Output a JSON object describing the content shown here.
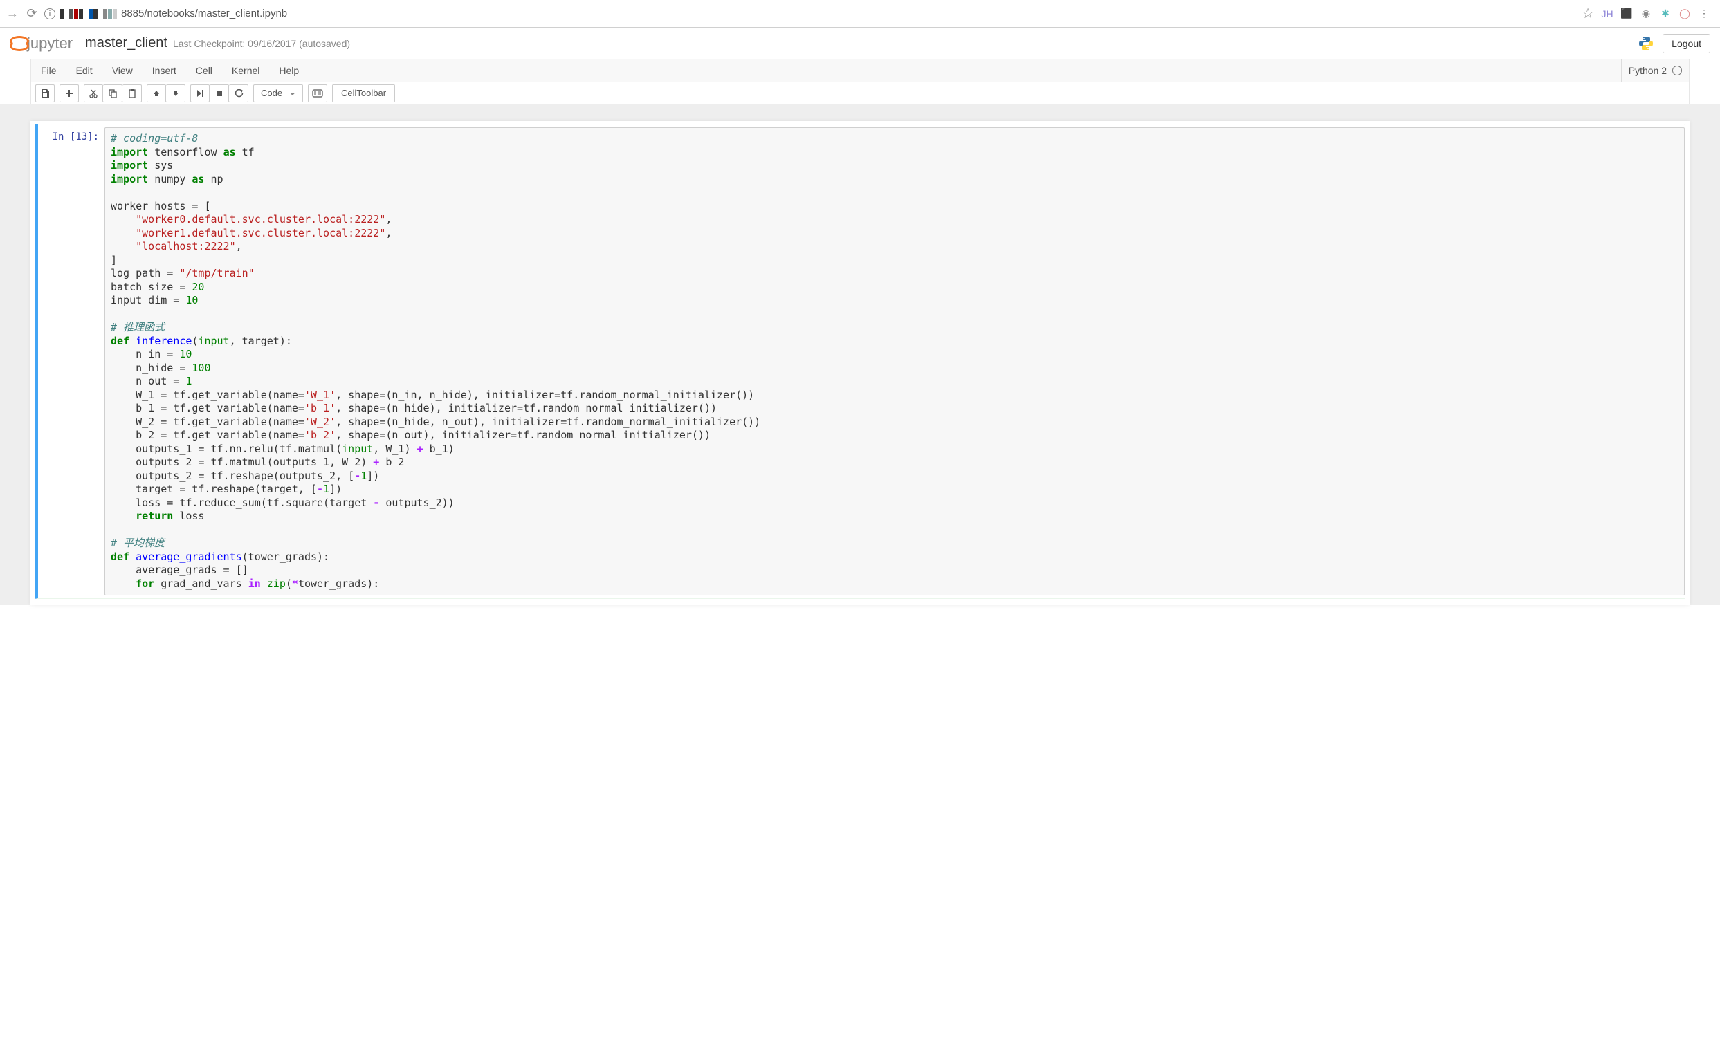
{
  "browser": {
    "url_text": "8885/notebooks/master_client.ipynb",
    "ext_icons": [
      {
        "name": "ext-jh",
        "glyph": "JH",
        "color": "#8b82d6"
      },
      {
        "name": "ext-red",
        "glyph": "⬛",
        "color": "#d66"
      },
      {
        "name": "ext-elephant",
        "glyph": "◉",
        "color": "#888"
      },
      {
        "name": "ext-asterisk",
        "glyph": "✱",
        "color": "#5bb"
      },
      {
        "name": "ext-circle",
        "glyph": "◯",
        "color": "#d88"
      },
      {
        "name": "ext-dots",
        "glyph": "⋮",
        "color": "#666"
      }
    ]
  },
  "header": {
    "logo_text": "jupyter",
    "notebook_name": "master_client",
    "checkpoint": "Last Checkpoint: 09/16/2017 (autosaved)",
    "logout": "Logout"
  },
  "menus": {
    "items": [
      "File",
      "Edit",
      "View",
      "Insert",
      "Cell",
      "Kernel",
      "Help"
    ],
    "kernel": "Python 2"
  },
  "toolbar": {
    "cell_type": "Code",
    "cell_toolbar": "CellToolbar"
  },
  "cell": {
    "prompt": "In [13]:",
    "code_lines": [
      [
        {
          "t": "# coding=utf-8",
          "c": "c-comment"
        }
      ],
      [
        {
          "t": "import",
          "c": "c-keyword"
        },
        {
          "t": " tensorflow "
        },
        {
          "t": "as",
          "c": "c-keyword"
        },
        {
          "t": " tf"
        }
      ],
      [
        {
          "t": "import",
          "c": "c-keyword"
        },
        {
          "t": " sys"
        }
      ],
      [
        {
          "t": "import",
          "c": "c-keyword"
        },
        {
          "t": " numpy "
        },
        {
          "t": "as",
          "c": "c-keyword"
        },
        {
          "t": " np"
        }
      ],
      [],
      [
        {
          "t": "worker_hosts = ["
        }
      ],
      [
        {
          "t": "    "
        },
        {
          "t": "\"worker0.default.svc.cluster.local:2222\"",
          "c": "c-string"
        },
        {
          "t": ","
        }
      ],
      [
        {
          "t": "    "
        },
        {
          "t": "\"worker1.default.svc.cluster.local:2222\"",
          "c": "c-string"
        },
        {
          "t": ","
        }
      ],
      [
        {
          "t": "    "
        },
        {
          "t": "\"localhost:2222\"",
          "c": "c-string"
        },
        {
          "t": ","
        }
      ],
      [
        {
          "t": "]"
        }
      ],
      [
        {
          "t": "log_path = "
        },
        {
          "t": "\"/tmp/train\"",
          "c": "c-string"
        }
      ],
      [
        {
          "t": "batch_size = "
        },
        {
          "t": "20",
          "c": "c-number"
        }
      ],
      [
        {
          "t": "input_dim = "
        },
        {
          "t": "10",
          "c": "c-number"
        }
      ],
      [],
      [
        {
          "t": "# 推理函式",
          "c": "c-comment"
        }
      ],
      [
        {
          "t": "def",
          "c": "c-keyword"
        },
        {
          "t": " "
        },
        {
          "t": "inference",
          "c": "c-def"
        },
        {
          "t": "("
        },
        {
          "t": "input",
          "c": "c-builtin"
        },
        {
          "t": ", target):"
        }
      ],
      [
        {
          "t": "    n_in = "
        },
        {
          "t": "10",
          "c": "c-number"
        }
      ],
      [
        {
          "t": "    n_hide = "
        },
        {
          "t": "100",
          "c": "c-number"
        }
      ],
      [
        {
          "t": "    n_out = "
        },
        {
          "t": "1",
          "c": "c-number"
        }
      ],
      [
        {
          "t": "    W_1 = tf.get_variable(name="
        },
        {
          "t": "'W_1'",
          "c": "c-string"
        },
        {
          "t": ", shape=(n_in, n_hide), initializer=tf.random_normal_initializer())"
        }
      ],
      [
        {
          "t": "    b_1 = tf.get_variable(name="
        },
        {
          "t": "'b_1'",
          "c": "c-string"
        },
        {
          "t": ", shape=(n_hide), initializer=tf.random_normal_initializer())"
        }
      ],
      [
        {
          "t": "    W_2 = tf.get_variable(name="
        },
        {
          "t": "'W_2'",
          "c": "c-string"
        },
        {
          "t": ", shape=(n_hide, n_out), initializer=tf.random_normal_initializer())"
        }
      ],
      [
        {
          "t": "    b_2 = tf.get_variable(name="
        },
        {
          "t": "'b_2'",
          "c": "c-string"
        },
        {
          "t": ", shape=(n_out), initializer=tf.random_normal_initializer())"
        }
      ],
      [
        {
          "t": "    outputs_1 = tf.nn.relu(tf.matmul("
        },
        {
          "t": "input",
          "c": "c-builtin"
        },
        {
          "t": ", W_1) "
        },
        {
          "t": "+",
          "c": "c-operator"
        },
        {
          "t": " b_1)"
        }
      ],
      [
        {
          "t": "    outputs_2 = tf.matmul(outputs_1, W_2) "
        },
        {
          "t": "+",
          "c": "c-operator"
        },
        {
          "t": " b_2"
        }
      ],
      [
        {
          "t": "    outputs_2 = tf.reshape(outputs_2, ["
        },
        {
          "t": "-",
          "c": "c-operator"
        },
        {
          "t": "1",
          "c": "c-number"
        },
        {
          "t": "])"
        }
      ],
      [
        {
          "t": "    target = tf.reshape(target, ["
        },
        {
          "t": "-",
          "c": "c-operator"
        },
        {
          "t": "1",
          "c": "c-number"
        },
        {
          "t": "])"
        }
      ],
      [
        {
          "t": "    loss = tf.reduce_sum(tf.square(target "
        },
        {
          "t": "-",
          "c": "c-operator"
        },
        {
          "t": " outputs_2))"
        }
      ],
      [
        {
          "t": "    "
        },
        {
          "t": "return",
          "c": "c-keyword"
        },
        {
          "t": " loss"
        }
      ],
      [],
      [
        {
          "t": "# 平均梯度",
          "c": "c-comment"
        }
      ],
      [
        {
          "t": "def",
          "c": "c-keyword"
        },
        {
          "t": " "
        },
        {
          "t": "average_gradients",
          "c": "c-def"
        },
        {
          "t": "(tower_grads):"
        }
      ],
      [
        {
          "t": "    average_grads = []"
        }
      ],
      [
        {
          "t": "    "
        },
        {
          "t": "for",
          "c": "c-keyword"
        },
        {
          "t": " grad_and_vars "
        },
        {
          "t": "in",
          "c": "c-operator-word"
        },
        {
          "t": " "
        },
        {
          "t": "zip",
          "c": "c-builtin"
        },
        {
          "t": "("
        },
        {
          "t": "*",
          "c": "c-operator"
        },
        {
          "t": "tower_grads):"
        }
      ]
    ]
  }
}
